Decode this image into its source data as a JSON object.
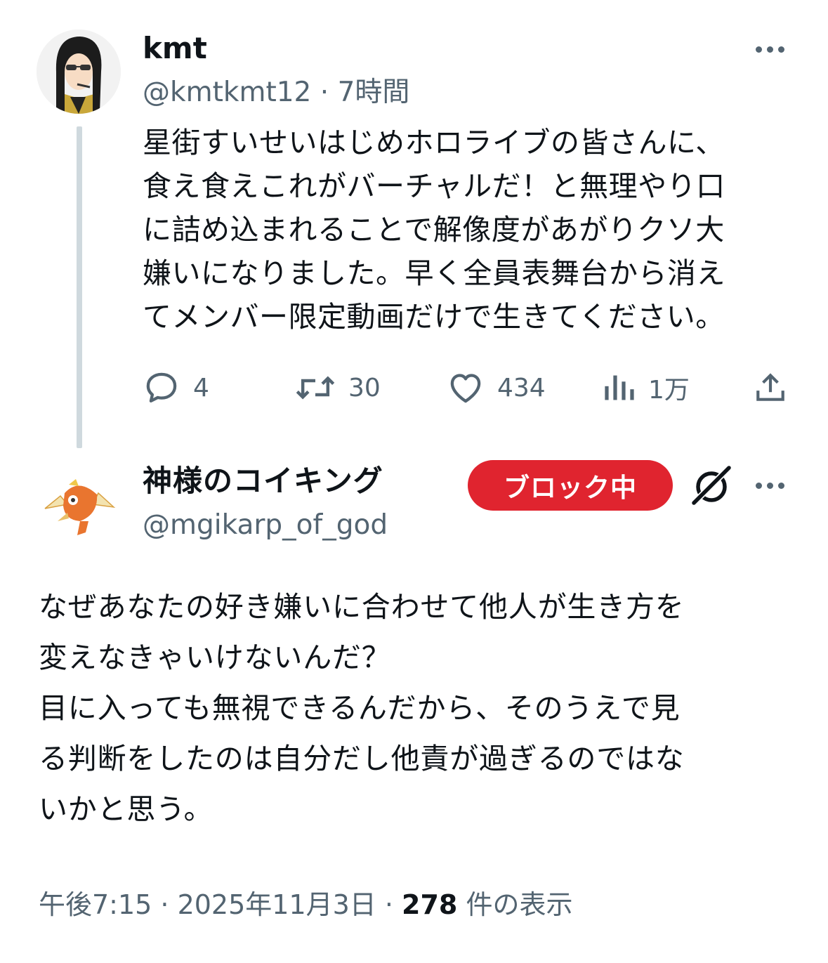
{
  "parent_tweet": {
    "display_name": "kmt",
    "handle": "@kmtkmt12",
    "separator": " · ",
    "time": "7時間",
    "text": "星街すいせいはじめホロライブの皆さんに、\n食え食えこれがバーチャルだ！と無理やり口\nに詰め込まれることで解像度があがりクソ大\n嫌いになりました。早く全員表舞台から消え\nてメンバー限定動画だけで生きてください。",
    "actions": {
      "replies": "4",
      "retweets": "30",
      "likes": "434",
      "views": "1万"
    }
  },
  "reply_tweet": {
    "display_name": "神様のコイキング",
    "handle": "@mgikarp_of_god",
    "block_label": "ブロック中",
    "text": "なぜあなたの好き嫌いに合わせて他人が生き方を\n変えなきゃいけないんだ？\n目に入っても無視できるんだから、そのうえで見\nる判断をしたのは自分だし他責が過ぎるのではな\nいかと思う。",
    "timestamp": "午後7:15 · 2025年11月3日 · ",
    "view_count": "278",
    "view_label": " 件の表示"
  },
  "icons": {
    "reply": "speech-bubble-icon",
    "retweet": "retweet-arrows-icon",
    "like": "heart-icon",
    "views": "bar-chart-icon",
    "share": "share-upload-icon",
    "more": "more-dots-icon",
    "grok": "grok-slash-icon"
  },
  "colors": {
    "block_pill": "#e0242f",
    "muted_text": "#536471",
    "thread_line": "#cfd9de"
  }
}
